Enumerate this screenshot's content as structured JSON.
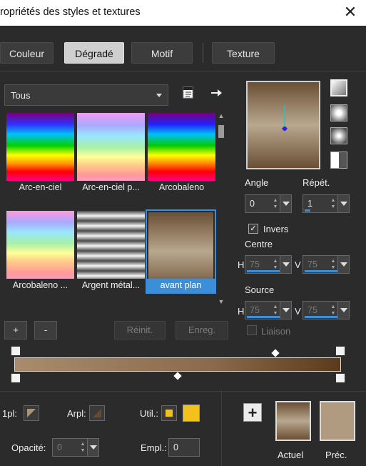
{
  "window": {
    "title": "ropriétés des styles et textures",
    "close_glyph": "✕"
  },
  "tabs": [
    {
      "label": "Couleur"
    },
    {
      "label": "Dégradé"
    },
    {
      "label": "Motif"
    },
    {
      "label": "Texture"
    }
  ],
  "selected_tab": "Dégradé",
  "category": {
    "value": "Tous"
  },
  "gradients": [
    {
      "label": "Arc-en-ciel"
    },
    {
      "label": "Arc-en-ciel p..."
    },
    {
      "label": "Arcobaleno"
    },
    {
      "label": "Arcobaleno ..."
    },
    {
      "label": "Argent métal..."
    },
    {
      "label": "avant plan"
    }
  ],
  "selected_gradient": "avant plan",
  "list_buttons": {
    "add": "+",
    "remove": "-",
    "reset": "Réinit.",
    "save": "Enreg."
  },
  "angle": {
    "label": "Angle",
    "value": "0"
  },
  "repeat": {
    "label": "Répét.",
    "value": "1"
  },
  "invert": {
    "label": "Invers",
    "checked": true,
    "check_glyph": "✓"
  },
  "centre": {
    "label": "Centre",
    "h_label": "H",
    "h_value": "75",
    "v_label": "V",
    "v_value": "75"
  },
  "source": {
    "label": "Source",
    "h_label": "H",
    "h_value": "75",
    "v_label": "V",
    "v_value": "75"
  },
  "link": {
    "label": "Liaison",
    "checked": false
  },
  "bottom": {
    "fg_label": "1pl:",
    "bg_label": "Arpl:",
    "use_label": "Util.:",
    "opacity_label": "Opacité:",
    "opacity_value": "0",
    "location_label": "Empl.:",
    "location_value": "0",
    "add_glyph": "+",
    "current_label": "Actuel",
    "previous_label": "Préc."
  },
  "colors": {
    "accent": "#3a8fd8",
    "use_swatch": "#f2c21b",
    "gradient_dark": "#6a4f33",
    "gradient_light": "#b9a78f",
    "previous_swatch": "#b09a80"
  }
}
